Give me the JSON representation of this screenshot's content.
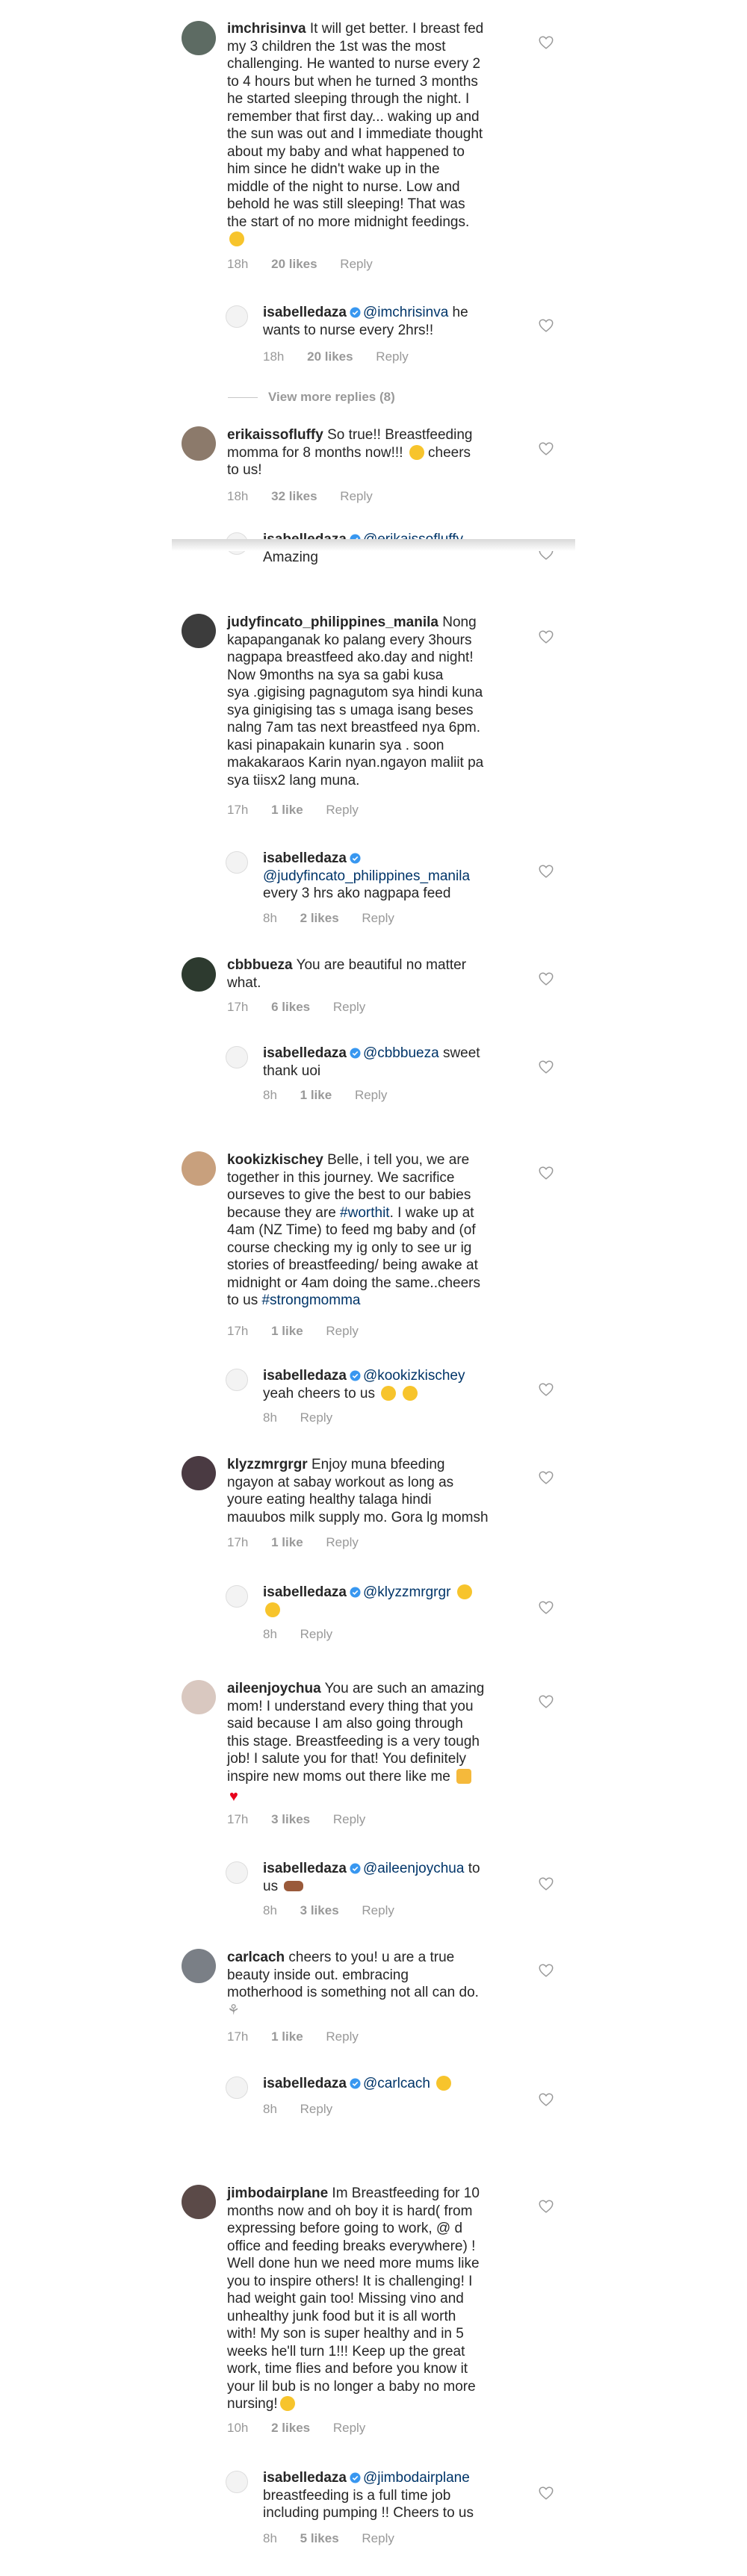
{
  "meta_reply": "Reply",
  "view_more": "View more replies (8)",
  "comments": [
    {
      "user": "imchrisinva",
      "lines": [
        "It will get better. I breast fed",
        "my 3 children the 1st was the most",
        "challenging. He wanted to nurse every 2",
        "to 4 hours but when he turned 3 months",
        "he started sleeping through the night. I",
        "remember that first day... waking up and",
        "the sun was out and I immediate thought",
        "about my baby and what happened to",
        "him since he didn't wake up in the",
        "middle of the night to nurse. Low and",
        "behold he was still sleeping! That was",
        "the start of no more midnight feedings."
      ],
      "time": "18h",
      "likes": "20 likes"
    },
    {
      "user": "isabelledaza",
      "mention": "@imchrisinva",
      "lines": [
        "he",
        "wants to nurse every 2hrs!!"
      ],
      "time": "18h",
      "likes": "20 likes"
    },
    {
      "user": "erikaissofluffy",
      "lines": [
        "So true!! Breastfeeding",
        "momma for 8 months now!!!",
        "cheers",
        "to us!"
      ],
      "time": "18h",
      "likes": "32 likes"
    },
    {
      "user": "isabelledaza",
      "mention": "@erikaissofluffy",
      "lines": [
        "Amazing"
      ]
    },
    {
      "user": "judyfincato_philippines_manila",
      "lines": [
        "Nong",
        "kapapanganak ko palang every  3hours",
        "nagpapa breastfeed ako.day and  night!",
        "Now 9months na sya  sa gabi kusa",
        "sya .gigising pagnagutom sya  hindi kuna",
        "sya  ginigising tas  s umaga isang beses",
        "nalng 7am tas  next breastfeed nya 6pm.",
        "kasi pinapakain kunarin sya . soon",
        "makakaraos Karin nyan.ngayon maliit pa",
        "sya  tiisx2 lang muna."
      ],
      "time": "17h",
      "likes": "1 like"
    },
    {
      "user": "isabelledaza",
      "mention": "@judyfincato_philippines_manila",
      "lines": [
        "every 3 hrs ako nagpapa feed"
      ],
      "time": "8h",
      "likes": "2 likes"
    },
    {
      "user": "cbbbueza",
      "lines": [
        "You are beautiful no matter",
        "what."
      ],
      "time": "17h",
      "likes": "6 likes"
    },
    {
      "user": "isabelledaza",
      "mention": "@cbbbueza",
      "lines": [
        "sweet",
        "thank uoi"
      ],
      "time": "8h",
      "likes": "1 like"
    },
    {
      "user": "kookizkischey",
      "lines": [
        "Belle, i tell you, we are",
        "together in this journey. We sacrifice",
        "ourseves to give the best to our babies",
        "because they are",
        "#worthit",
        ". I wake up at",
        "4am (NZ Time) to feed mg baby and (of",
        "course checking my ig only to see ur ig",
        "stories of breastfeeding/ being awake at",
        "midnight or 4am doing the same..cheers",
        "to us",
        "#strongmomma"
      ],
      "time": "17h",
      "likes": "1 like"
    },
    {
      "user": "isabelledaza",
      "mention": "@kookizkischey",
      "lines": [
        "yeah cheers to us"
      ],
      "time": "8h"
    },
    {
      "user": "klyzzmrgrgr",
      "lines": [
        "Enjoy muna bfeeding",
        "ngayon at sabay workout as long as",
        "youre eating healthy talaga hindi",
        "mauubos milk supply mo. Gora lg momsh"
      ],
      "time": "17h",
      "likes": "1 like"
    },
    {
      "user": "isabelledaza",
      "mention": "@klyzzmrgrgr",
      "lines": [],
      "time": "8h"
    },
    {
      "user": "aileenjoychua",
      "lines": [
        "You are such an amazing",
        "mom! I understand every thing that you",
        "said because I am also going through",
        "this stage. Breastfeeding is a very tough",
        "job! I salute you for that! You definitely",
        "inspire new moms out there like me"
      ],
      "time": "17h",
      "likes": "3 likes"
    },
    {
      "user": "isabelledaza",
      "mention": "@aileenjoychua",
      "lines": [
        "to",
        "us"
      ],
      "time": "8h",
      "likes": "3 likes"
    },
    {
      "user": "carlcach",
      "lines": [
        "cheers to you! u are a true",
        "beauty inside out. embracing",
        "motherhood is something not all can do."
      ],
      "time": "17h",
      "likes": "1 like"
    },
    {
      "user": "isabelledaza",
      "mention": "@carlcach",
      "lines": [],
      "time": "8h"
    },
    {
      "user": "jimbodairplane",
      "lines": [
        "Im Breastfeeding for 10",
        "months now and oh boy it is hard( from",
        "expressing before going to work, @ d",
        "office and feeding breaks everywhere) !",
        "Well done hun we need more mums like",
        "you to inspire others! It is challenging! I",
        "had weight gain too! Missing vino and",
        "unhealthy junk food but it is all worth",
        "with! My son is super healthy  and in 5",
        "weeks he'll turn 1!!! Keep up the great",
        "work, time flies and before you know it",
        "your lil bub is no longer a baby no more",
        "nursing!"
      ],
      "time": "10h",
      "likes": "2 likes"
    },
    {
      "user": "isabelledaza",
      "mention": "@jimbodairplane",
      "lines": [
        "breastfeeding is a full time job",
        "including pumping !! Cheers to us"
      ],
      "time": "8h",
      "likes": "5 likes"
    }
  ],
  "colors": {
    "text": "#262626",
    "meta": "#999999",
    "link": "#003569",
    "verified": "#3897f0"
  }
}
